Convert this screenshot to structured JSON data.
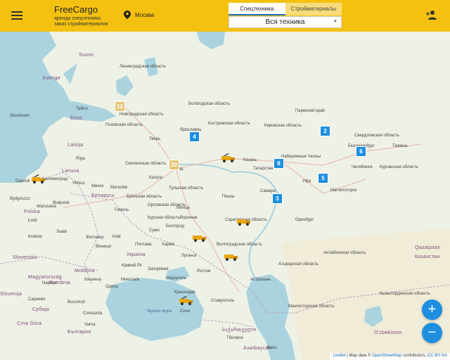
{
  "header": {
    "menu_icon": "menu-icon",
    "brand_title": "FreeCargo",
    "brand_subtitle_1": "аренда спецтехники,",
    "brand_subtitle_2": "заказ стройматериалов",
    "location_icon": "location-pin-icon",
    "location": "Москва",
    "tabs": [
      {
        "label": "Спецтехника",
        "active": true
      },
      {
        "label": "Стройматериалы",
        "active": false
      }
    ],
    "category_select": "Вся техника",
    "user_icon": "add-user-icon",
    "bg_color": "#f4c110"
  },
  "map": {
    "clusters": [
      {
        "count": "12",
        "style": "big"
      },
      {
        "count": "4",
        "style": "blue"
      },
      {
        "count": "20",
        "style": "big"
      },
      {
        "count": "2",
        "style": "blue"
      },
      {
        "count": "6",
        "style": "blue"
      },
      {
        "count": "8",
        "style": "blue"
      },
      {
        "count": "5",
        "style": "blue"
      },
      {
        "count": "3",
        "style": "blue"
      }
    ],
    "truck_icon": "truck-marker-icon",
    "labels": {
      "sweden": "Sverige",
      "finland": "Suomi",
      "stockholm": "Stockholm",
      "tallinn": "Tallinn",
      "eesti": "Eesti",
      "latvia": "Latvija",
      "lietuva": "Lietuva",
      "vilnius": "Vilnius",
      "belarus": "Беларусь",
      "minsk": "Минск",
      "polska": "Polska",
      "warszawa": "Warszawa",
      "ukraine": "Україна",
      "kiev": "Київ",
      "moldova": "Moldova",
      "romania": "România",
      "moscow": "Москва",
      "kazan": "Казань",
      "yekaterinburg": "Екатеринбург",
      "tyumen": "Тюмень",
      "magnitogorsk": "Магнитогорск",
      "orenburg": "Оренбург",
      "astrakhan": "Астрахань",
      "kazakhstan": "Казахстан",
      "qazaqstan": "Qazaqstan",
      "uzbekiston": "O'zbekiston",
      "samara": "Самара",
      "voronezh": "Воронеж",
      "lipetsk": "Липецк",
      "sochi": "Сочи",
      "poltava": "Полтава",
      "kharkiv": "Харків",
      "lugansk": "Луганск",
      "rostov": "Ростов",
      "mogilev": "Могилёв",
      "gomel": "Гомель",
      "chisinau": "Кишинэу",
      "bucuresti": "București",
      "bulgaria": "България",
      "sarajevo": "Сараево",
      "srbija": "Србија",
      "magyar": "Magyarország",
      "slovensko": "Slovensko",
      "tbilisi": "Тбилиси",
      "sakartvelo": "საქართველო",
      "azerbaijan": "Азərbaycan",
      "baku": "Baku",
      "nizhny": "Набережные Челны",
      "kirov": "Кировская область",
      "kostroma": "Костромская область",
      "yaroslavl": "Ярославль",
      "vologda": "Вологодская область",
      "penza": "Пенза",
      "tatarstan": "Татарстан",
      "ufa": "Уфа",
      "chelyabinsk": "Челябинск",
      "kurgan": "Курганская область",
      "aktobe": "Актюбинская область",
      "atyrau": "Атырауская область",
      "mangistau": "Мангистауская область",
      "karaganda": "Кызылординская область",
      "sverdlovsk": "Свердловская область",
      "perm": "Пермский край",
      "tula": "Тульская область",
      "bryansk": "Брянская область",
      "kursk": "Курская область",
      "volgograd": "Волгоградская область",
      "saratov": "Саратовская область",
      "orel": "Орловская область",
      "kaluga": "Калуга",
      "smolensk": "Смоленская область",
      "tver": "Тверь",
      "pskov": "Псковская область",
      "novgorod": "Новгородская область",
      "leningrad": "Ленинградская область",
      "riga": "Rīga",
      "kaliningrad": "Калининград",
      "gdansk": "Gdańsk",
      "bialystok": "Białystok",
      "bydgoszcz": "Bydgoszcz",
      "lodz": "Łódź",
      "krakow": "Kraków",
      "lviv": "Львів",
      "vinnytsia": "Вінниця",
      "zhytomyr": "Житомир",
      "odesa": "Одеса",
      "mykolaiv": "Миколаїв",
      "kryvyi": "Кривий Ріг",
      "zaporizhzhia": "Запоріжжя",
      "mariupol": "Маріуполь",
      "krasnodar": "Краснодар",
      "stavropol": "Ставрополь",
      "varna": "Varna",
      "constanta": "Constanța",
      "slovenia": "Slovenija",
      "crna": "Crna Gora",
      "napoca": "Napoca",
      "sumy": "Суми",
      "belgorod": "Белгород"
    },
    "sea_labels": {
      "black_sea": "Черное море"
    }
  },
  "zoom": {
    "in_label": "+",
    "out_label": "−"
  },
  "attribution": {
    "leaflet": "Leaflet",
    "text": " | Map data © ",
    "osm": "OpenStreetMap",
    "contrib": " contributors, ",
    "license": "CC-BY-SA"
  }
}
